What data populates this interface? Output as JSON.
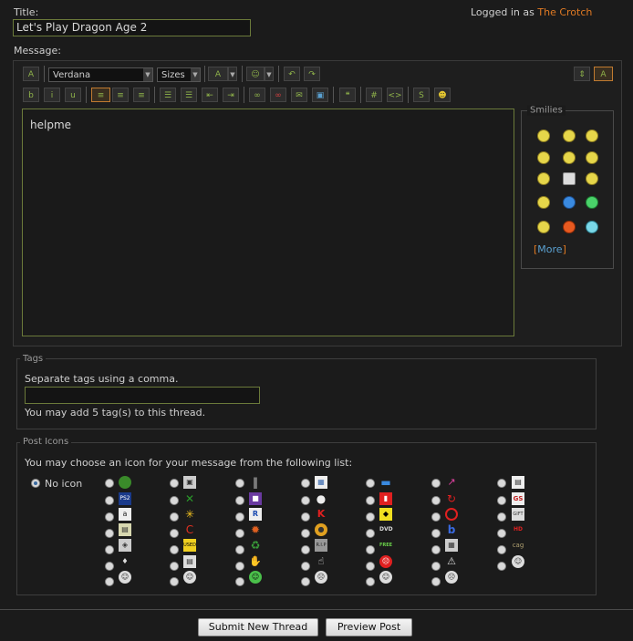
{
  "header": {
    "title_label": "Title:",
    "logged_in_prefix": "Logged in as",
    "username": "The Crotch"
  },
  "title_field": {
    "value": "Let's Play Dragon Age 2"
  },
  "message": {
    "label": "Message:",
    "font_select": "Verdana",
    "size_select": "Sizes",
    "body": "helpme"
  },
  "smilies": {
    "legend": "Smilies",
    "more_open": "[",
    "more_label": "More",
    "more_close": "]"
  },
  "tags": {
    "legend": "Tags",
    "hint": "Separate tags using a comma.",
    "value": "",
    "limit_text": "You may add 5 tag(s) to this thread."
  },
  "post_icons": {
    "legend": "Post Icons",
    "intro": "You may choose an icon for your message from the following list:",
    "no_icon_label": "No icon"
  },
  "buttons": {
    "submit": "Submit New Thread",
    "preview": "Preview Post"
  },
  "colors": {
    "link": "#e07a23",
    "field_border": "#6b7a3a",
    "background": "#1b1b1b"
  }
}
